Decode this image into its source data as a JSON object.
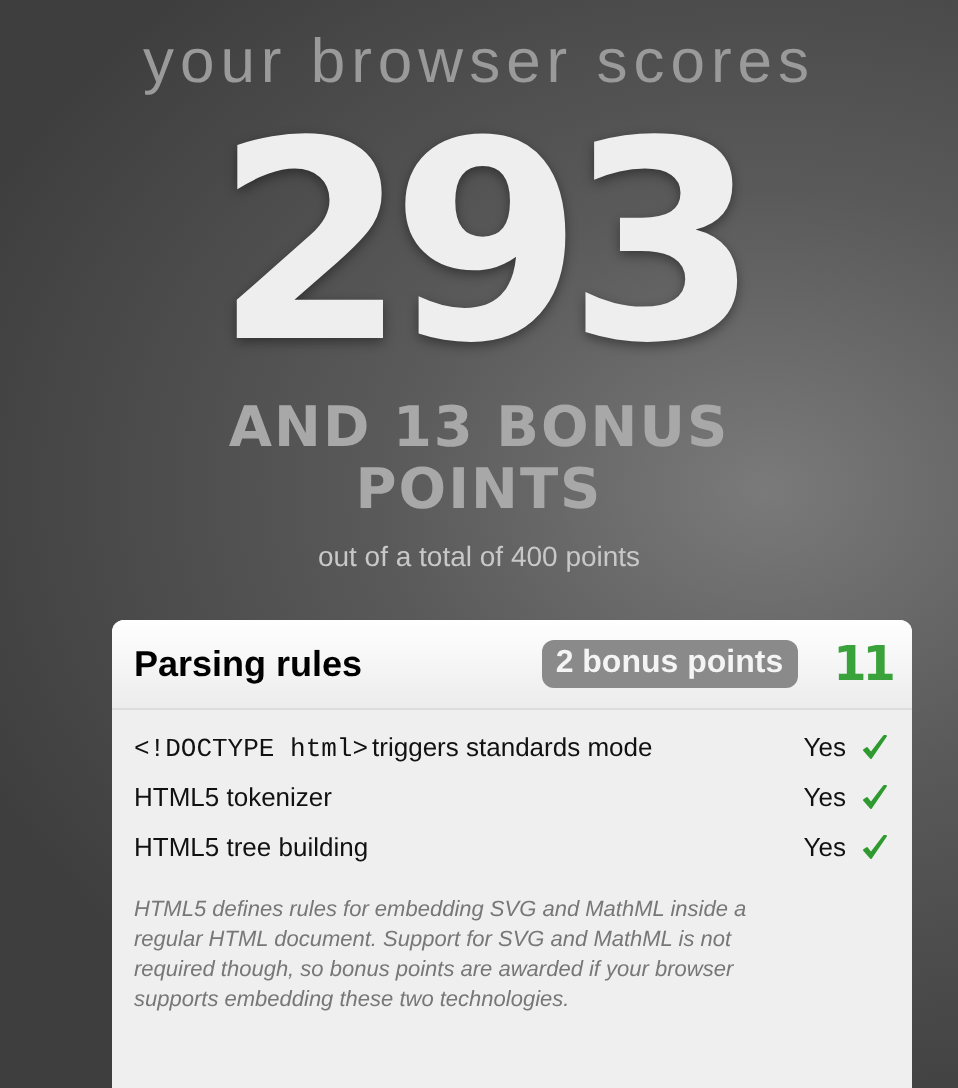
{
  "heading": "your browser scores",
  "score": "293",
  "bonus": "AND 13 BONUS POINTS",
  "total": "out of a total of 400 points",
  "section": {
    "title": "Parsing rules",
    "bonus_badge": "2 bonus points",
    "points": "11",
    "tests": [
      {
        "code": "<!DOCTYPE html>",
        "label": "triggers standards mode",
        "result": "Yes",
        "passed": true
      },
      {
        "label": "HTML5 tokenizer",
        "result": "Yes",
        "passed": true
      },
      {
        "label": "HTML5 tree building",
        "result": "Yes",
        "passed": true
      }
    ],
    "note": "HTML5 defines rules for embedding SVG and MathML inside a regular HTML document. Support for SVG and MathML is not required though, so bonus points are awarded if your browser supports embedding these two technologies."
  }
}
